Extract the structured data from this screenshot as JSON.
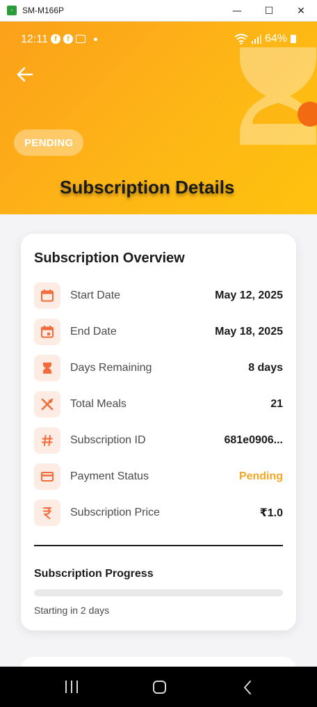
{
  "window": {
    "title": "SM-M166P",
    "icon_name": "app-icon",
    "controls": {
      "minimize": "—",
      "maximize": "☐",
      "close": "✕"
    }
  },
  "status_bar": {
    "time": "12:11",
    "battery": "64%",
    "icons": [
      "facebook-icon",
      "facebook-icon",
      "gallery-icon",
      "dot-icon",
      "wifi-icon",
      "signal-icon",
      "battery-icon"
    ]
  },
  "header": {
    "badge": "PENDING",
    "title": "Subscription Details",
    "colors": {
      "gradient_start": "#fca01a",
      "gradient_end": "#ffc20e"
    }
  },
  "overview": {
    "title": "Subscription Overview",
    "rows": [
      {
        "icon": "calendar-icon",
        "label": "Start Date",
        "value": "May 12, 2025"
      },
      {
        "icon": "calendar-event-icon",
        "label": "End Date",
        "value": "May 18, 2025"
      },
      {
        "icon": "hourglass-icon",
        "label": "Days Remaining",
        "value": "8 days"
      },
      {
        "icon": "utensils-icon",
        "label": "Total Meals",
        "value": "21"
      },
      {
        "icon": "hash-icon",
        "label": "Subscription ID",
        "value": "681e0906..."
      },
      {
        "icon": "credit-card-icon",
        "label": "Payment Status",
        "value": "Pending"
      },
      {
        "icon": "rupee-icon",
        "label": "Subscription Price",
        "value": "₹1.0"
      }
    ]
  },
  "progress": {
    "title": "Subscription Progress",
    "value": 0,
    "text": "Starting in 2 days"
  },
  "colors": {
    "accent": "#f26b3a",
    "icon_bg": "#fdece4",
    "pending": "#f5a623"
  }
}
